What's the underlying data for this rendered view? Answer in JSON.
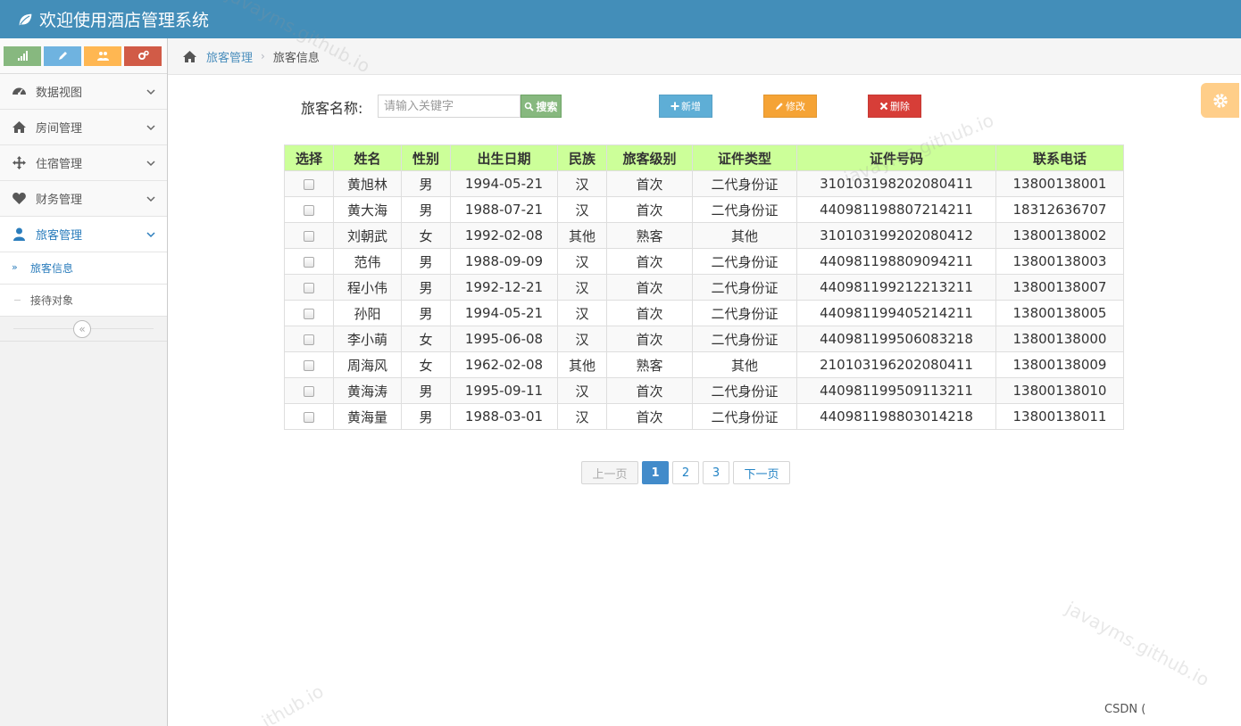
{
  "app": {
    "title": "欢迎使用酒店管理系统",
    "brand_icon": "leaf-icon"
  },
  "shortcuts": [
    {
      "icon": "signal-icon",
      "color": "#87b87f"
    },
    {
      "icon": "pencil-icon",
      "color": "#6fb3e0"
    },
    {
      "icon": "users-icon",
      "color": "#ffb752"
    },
    {
      "icon": "cogs-icon",
      "color": "#d15b47"
    }
  ],
  "sidebar": {
    "items": [
      {
        "label": "数据视图",
        "icon": "dashboard-icon"
      },
      {
        "label": "房间管理",
        "icon": "home-icon"
      },
      {
        "label": "住宿管理",
        "icon": "move-icon"
      },
      {
        "label": "财务管理",
        "icon": "heart-icon"
      },
      {
        "label": "旅客管理",
        "icon": "user-icon",
        "active": true
      }
    ],
    "submenu": [
      {
        "label": "旅客信息",
        "active": true
      },
      {
        "label": "接待对象"
      }
    ],
    "collapse_glyph": "«"
  },
  "breadcrumb": {
    "parent": "旅客管理",
    "current": "旅客信息",
    "separator": "›"
  },
  "toolbar": {
    "search_label": "旅客名称:",
    "search_placeholder": "请输入关键字",
    "search_value": "",
    "search_button": "搜索",
    "add_button": "新增",
    "edit_button": "修改",
    "delete_button": "删除"
  },
  "table": {
    "columns": [
      "选择",
      "姓名",
      "性别",
      "出生日期",
      "民族",
      "旅客级别",
      "证件类型",
      "证件号码",
      "联系电话"
    ],
    "rows": [
      [
        "黄旭林",
        "男",
        "1994-05-21",
        "汉",
        "首次",
        "二代身份证",
        "310103198202080411",
        "13800138001"
      ],
      [
        "黄大海",
        "男",
        "1988-07-21",
        "汉",
        "首次",
        "二代身份证",
        "440981198807214211",
        "18312636707"
      ],
      [
        "刘朝武",
        "女",
        "1992-02-08",
        "其他",
        "熟客",
        "其他",
        "310103199202080412",
        "13800138002"
      ],
      [
        "范伟",
        "男",
        "1988-09-09",
        "汉",
        "首次",
        "二代身份证",
        "440981198809094211",
        "13800138003"
      ],
      [
        "程小伟",
        "男",
        "1992-12-21",
        "汉",
        "首次",
        "二代身份证",
        "440981199212213211",
        "13800138007"
      ],
      [
        "孙阳",
        "男",
        "1994-05-21",
        "汉",
        "首次",
        "二代身份证",
        "440981199405214211",
        "13800138005"
      ],
      [
        "李小萌",
        "女",
        "1995-06-08",
        "汉",
        "首次",
        "二代身份证",
        "440981199506083218",
        "13800138000"
      ],
      [
        "周海风",
        "女",
        "1962-02-08",
        "其他",
        "熟客",
        "其他",
        "210103196202080411",
        "13800138009"
      ],
      [
        "黄海涛",
        "男",
        "1995-09-11",
        "汉",
        "首次",
        "二代身份证",
        "440981199509113211",
        "13800138010"
      ],
      [
        "黄海量",
        "男",
        "1988-03-01",
        "汉",
        "首次",
        "二代身份证",
        "440981198803014218",
        "13800138011"
      ]
    ]
  },
  "pagination": {
    "prev": "上一页",
    "pages": [
      "1",
      "2",
      "3"
    ],
    "current": "1",
    "next": "下一页"
  },
  "watermark": "javayms.github.io",
  "watermark_partial": "ithub.io",
  "footer_mark": "CSDN (",
  "colors": {
    "navbar": "#438eb9",
    "table_header": "#ccff99",
    "active_link": "#2b7dbc",
    "page_active": "#428bca"
  }
}
